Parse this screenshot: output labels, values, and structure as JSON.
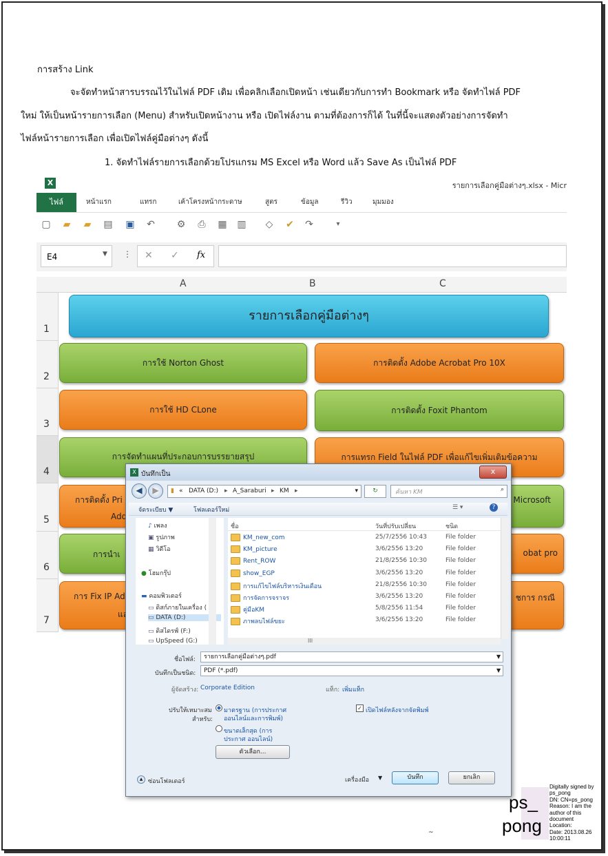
{
  "doc": {
    "heading": "การสร้าง Link",
    "para_line1": "จะจัดทำหน้าสารบรรณไว้ในไฟล์ PDF เดิม เพื่อคลิกเลือกเปิดหน้า เช่นเดียวกับการทำ Bookmark หรือ จัดทำไฟล์ PDF",
    "para_line2": "ใหม่ ให้เป็นหน้ารายการเลือก (Menu) สำหรับเปิดหน้างาน หรือ เปิดไฟล์งาน ตามที่ต้องการก็ได้ ในที่นี้จะแสดงตัวอย่างการจัดทำ",
    "para_line3": "ไฟล์หน้ารายการเลือก เพื่อเปิดไฟล์คู่มือต่างๆ ดังนี้",
    "step1": "1. จัดทำไฟล์รายการเลือกด้วยโปรแกรม MS Excel หรือ Word แล้ว Save As เป็นไฟล์ PDF",
    "footer_mark": "~"
  },
  "excel": {
    "window_title": "รายการเลือกคู่มือต่างๆ.xlsx - Micr",
    "tabs": [
      "ไฟล์",
      "หน้าแรก",
      "แทรก",
      "เค้าโครงหน้ากระดาษ",
      "สูตร",
      "ข้อมูล",
      "รีวิว",
      "มุมมอง"
    ],
    "name_box": "E4",
    "fx": "fx",
    "columns": [
      "A",
      "B",
      "C"
    ],
    "rows": [
      "1",
      "2",
      "3",
      "4",
      "5",
      "6",
      "7"
    ],
    "title_button": "รายการเลือกคู่มือต่างๆ",
    "buttons_left": [
      "การใช้ Norton Ghost",
      "การใช้ HD CLone",
      "การจัดทำแผนที่ประกอบการบรรยายสรุป",
      "การติดตั้ง Pri",
      "Add",
      "การนำเ",
      "การ Fix IP Ad",
      "แล"
    ],
    "buttons_right": [
      "การติดตั้ง Adobe Acrobat Pro 10X",
      "การติดตั้ง Foxit Phantom",
      "การแทรก Field ในไฟล์ PDF เพื่อแก้ไขเพิ่มเติมข้อความ",
      "N Microsoft",
      "obat pro",
      "ชการ กรณี"
    ]
  },
  "dialog": {
    "title": "บันทึกเป็น",
    "close": "x",
    "breadcrumb": [
      "«",
      "DATA (D:)",
      "A_Saraburi",
      "KM"
    ],
    "search_placeholder": "ค้นหา KM",
    "organize": "จัดระเบียบ ▼",
    "new_folder": "โฟลเดอร์ใหม่",
    "nav_items": [
      "เพลง",
      "รูปภาพ",
      "วิดีโอ",
      "โฮมกรุ๊ป",
      "คอมพิวเตอร์",
      "ดิสก์ภายในเครื่อง (",
      "DATA (D:)",
      "ดิสไดรฟ์ (F:)",
      "UpSpeed (G:)"
    ],
    "col_headers": [
      "ชื่อ",
      "วันที่ปรับเปลี่ยน",
      "ชนิด"
    ],
    "files": [
      {
        "name": "KM_new_com",
        "date": "25/7/2556 10:43",
        "type": "File folder"
      },
      {
        "name": "KM_picture",
        "date": "3/6/2556 13:20",
        "type": "File folder"
      },
      {
        "name": "Rent_ROW",
        "date": "21/8/2556 10:30",
        "type": "File folder"
      },
      {
        "name": "show_EGP",
        "date": "3/6/2556 13:20",
        "type": "File folder"
      },
      {
        "name": "การแก้ไขไฟล์บริหารเงินเดือน",
        "date": "21/8/2556 10:30",
        "type": "File folder"
      },
      {
        "name": "การจัดการจราจร",
        "date": "3/6/2556 13:20",
        "type": "File folder"
      },
      {
        "name": "คู่มือKM",
        "date": "5/8/2556 11:54",
        "type": "File folder"
      },
      {
        "name": "ภาพลบไฟล์ขยะ",
        "date": "3/6/2556 13:20",
        "type": "File folder"
      }
    ],
    "hscroll_mark": "III",
    "filename_label": "ชื่อไฟล์:",
    "filename_value": "รายการเลือกคู่มือต่างๆ.pdf",
    "savetype_label": "บันทึกเป็นชนิด:",
    "savetype_value": "PDF (*.pdf)",
    "author_label": "ผู้จัดสร้าง:",
    "author_value": "Corporate Edition",
    "tags_label": "แท็ก:",
    "tags_value": "เพิ่มแท็ก",
    "optimize_label1": "ปรับให้เหมาะสม",
    "optimize_label2": "สำหรับ:",
    "opt1_l1": "มาตรฐาน (การประกาศ",
    "opt1_l2": "ออนไลน์และการพิมพ์)",
    "opt2_l1": "ขนาดเล็กสุด (การ",
    "opt2_l2": "ประกาศ ออนไลน์)",
    "open_after": "เปิดไฟล์หลังจากจัดพิมพ์",
    "options_btn": "ตัวเลือก...",
    "hide_folders": "ซ่อนโฟลเดอร์",
    "tools": "เครื่องมือ",
    "save_btn": "บันทึก",
    "cancel_btn": "ยกเลิก"
  },
  "signature": {
    "name_line1": "ps_",
    "name_line2": "pong",
    "details": [
      "Digitally signed by",
      "ps_pong",
      "DN: CN=ps_pong",
      "Reason: I am the",
      "author of this",
      "document",
      "Location:",
      "Date: 2013.08.26",
      "10:00:11"
    ]
  }
}
